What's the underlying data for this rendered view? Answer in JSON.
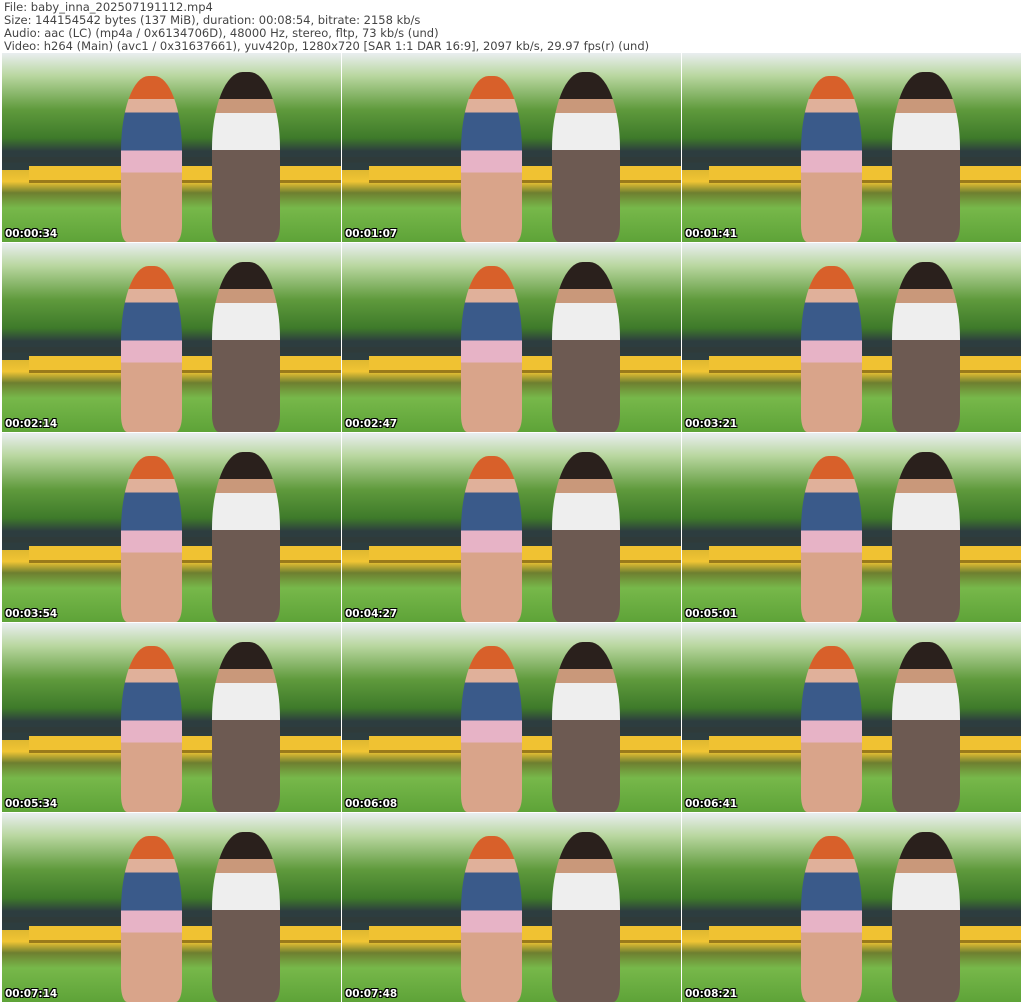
{
  "header": {
    "file": "File: baby_inna_202507191112.mp4",
    "size": "Size: 144154542 bytes (137 MiB), duration: 00:08:54, bitrate: 2158 kb/s",
    "audio": "Audio: aac (LC) (mp4a / 0x6134706D), 48000 Hz, stereo, fltp, 73 kb/s (und)",
    "video": "Video: h264 (Main) (avc1 / 0x31637661), yuv420p, 1280x720 [SAR 1:1 DAR 16:9], 2097 kb/s, 29.97 fps(r) (und)"
  },
  "thumbnails": [
    {
      "timestamp": "00:00:34"
    },
    {
      "timestamp": "00:01:07"
    },
    {
      "timestamp": "00:01:41"
    },
    {
      "timestamp": "00:02:14"
    },
    {
      "timestamp": "00:02:47"
    },
    {
      "timestamp": "00:03:21"
    },
    {
      "timestamp": "00:03:54"
    },
    {
      "timestamp": "00:04:27"
    },
    {
      "timestamp": "00:05:01"
    },
    {
      "timestamp": "00:05:34"
    },
    {
      "timestamp": "00:06:08"
    },
    {
      "timestamp": "00:06:41"
    },
    {
      "timestamp": "00:07:14"
    },
    {
      "timestamp": "00:07:48"
    },
    {
      "timestamp": "00:08:21"
    }
  ]
}
